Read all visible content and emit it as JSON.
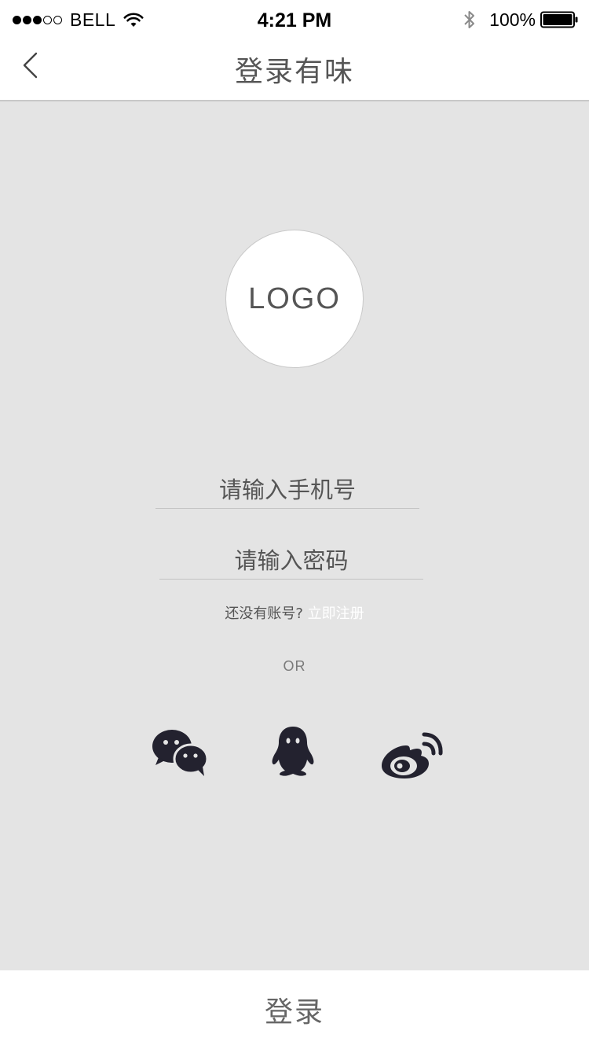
{
  "status_bar": {
    "carrier": "BELL",
    "time": "4:21 PM",
    "battery": "100%",
    "signal_dots_filled": 3,
    "signal_dots_total": 5
  },
  "nav": {
    "title": "登录有味",
    "back_icon": "chevron-left-icon"
  },
  "logo": {
    "text": "LOGO"
  },
  "form": {
    "phone_placeholder": "请输入手机号",
    "phone_value": "",
    "password_placeholder": "请输入密码",
    "password_value": "",
    "register_prompt": "还没有账号?",
    "register_link": "立即注册",
    "register_link_color": "#ffffff"
  },
  "divider_text": "OR",
  "social": [
    {
      "name": "wechat",
      "icon": "wechat-icon"
    },
    {
      "name": "qq",
      "icon": "qq-icon"
    },
    {
      "name": "weibo",
      "icon": "weibo-icon"
    }
  ],
  "login_button": {
    "label": "登录"
  },
  "colors": {
    "background": "#e4e4e4",
    "icon": "#23222f",
    "text": "#555555"
  }
}
